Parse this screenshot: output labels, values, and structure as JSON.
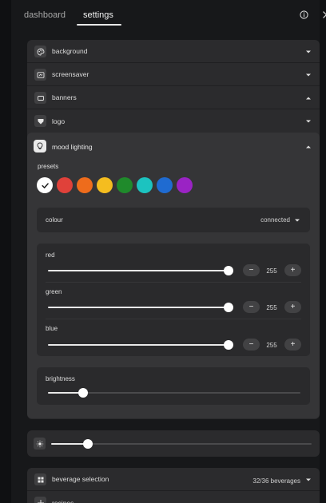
{
  "tabs": [
    {
      "label": "dashboard",
      "active": false
    },
    {
      "label": "settings",
      "active": true
    }
  ],
  "top_icons": [
    "info-icon",
    "close-icon"
  ],
  "sections": [
    {
      "label": "background",
      "icon": "palette-icon",
      "chevron": "down"
    },
    {
      "label": "screensaver",
      "icon": "screensaver-icon",
      "chevron": "down"
    },
    {
      "label": "banners",
      "icon": "banner-icon",
      "chevron": "up"
    },
    {
      "label": "logo",
      "icon": "badge-icon",
      "chevron": "down"
    }
  ],
  "mood": {
    "label": "mood lighting",
    "icon": "lightbulb-icon",
    "chevron": "up",
    "presets_label": "presets",
    "presets": [
      "#ffffff",
      "#e0413a",
      "#ee6c1c",
      "#f5bd1f",
      "#1f8a2b",
      "#1cc3c0",
      "#1f6bd1",
      "#9a23c4"
    ],
    "selected_preset": 0,
    "colour": {
      "label": "colour",
      "value": "connected"
    },
    "channels": [
      {
        "label": "red",
        "value": "255",
        "level": 1.0
      },
      {
        "label": "green",
        "value": "255",
        "level": 1.0
      },
      {
        "label": "blue",
        "value": "255",
        "level": 1.0
      }
    ],
    "stepper": {
      "minus": "−",
      "plus": "+"
    },
    "brightness": {
      "label": "brightness",
      "level": 0.14
    }
  },
  "main_slider": {
    "icon": "sun-icon",
    "level": 0.14
  },
  "beverage": {
    "label": "beverage selection",
    "icon": "grid-icon",
    "value": "32/36 beverages"
  },
  "next_section": {
    "label": "recipes",
    "icon": "move-icon"
  },
  "colors": {
    "panel": "#2b2b2d",
    "mood_panel": "#353537",
    "inner_box": "#2a2a2c",
    "accent": "#ffffff"
  }
}
